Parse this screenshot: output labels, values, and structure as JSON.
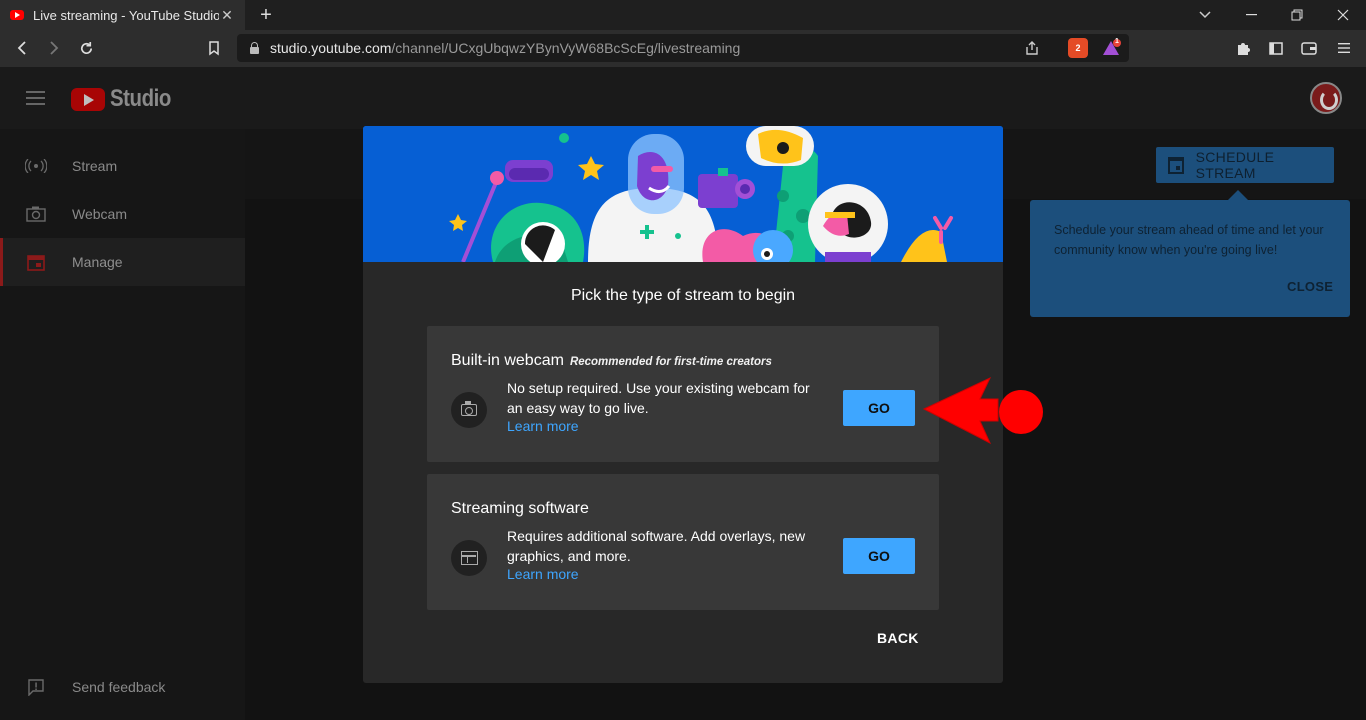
{
  "browser": {
    "tab_title": "Live streaming - YouTube Studio",
    "tab_close": "✕",
    "new_tab": "+",
    "url_host": "studio.youtube.com",
    "url_path": "/channel/UCxgUbqwzYBynVyW68BcScEg/livestreaming",
    "brave_badge": "2",
    "rewards_badge": "1"
  },
  "studio": {
    "logo_text": "Studio"
  },
  "sidebar": {
    "items": [
      {
        "label": "Stream",
        "icon": "stream-icon"
      },
      {
        "label": "Webcam",
        "icon": "webcam-icon"
      },
      {
        "label": "Manage",
        "icon": "calendar-icon",
        "active": true
      }
    ],
    "feedback": "Send feedback"
  },
  "schedule": {
    "button_label": "SCHEDULE STREAM",
    "tooltip_text": "Schedule your stream ahead of time and let your community know when you're going live!",
    "tooltip_close": "CLOSE"
  },
  "modal": {
    "title": "Pick the type of stream to begin",
    "options": [
      {
        "title": "Built-in webcam",
        "recommended": "Recommended for first-time creators",
        "description": "No setup required. Use your existing webcam for an easy way to go live.",
        "link": "Learn more",
        "button": "GO"
      },
      {
        "title": "Streaming software",
        "recommended": "",
        "description": "Requires additional software. Add overlays, new graphics, and more.",
        "link": "Learn more",
        "button": "GO"
      }
    ],
    "back": "BACK"
  },
  "colors": {
    "accent_blue": "#3ea6ff",
    "hero_blue": "#065fd4",
    "arrow_red": "#ff0000"
  }
}
